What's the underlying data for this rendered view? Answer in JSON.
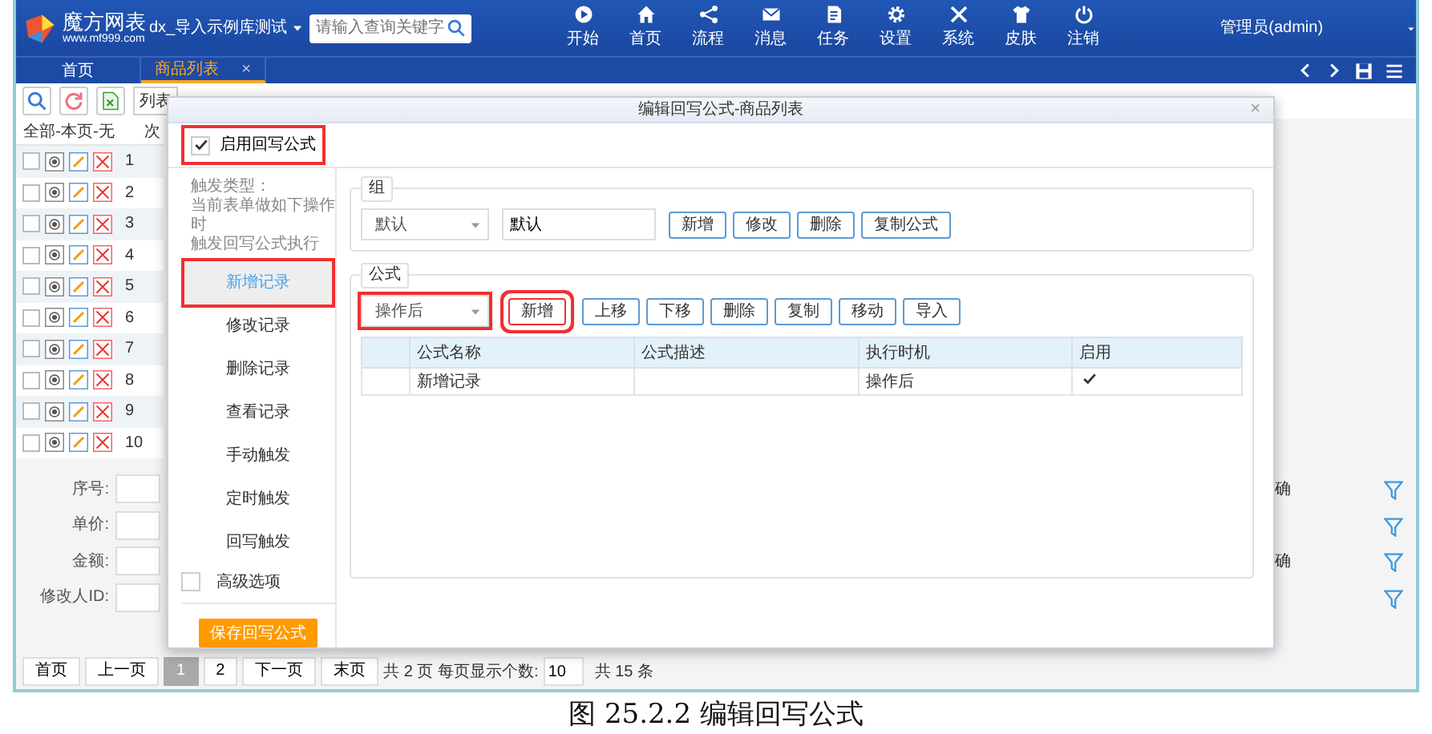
{
  "header": {
    "logo_title": "魔方网表",
    "logo_url": "www.mf999.com",
    "app_switcher": "dx_导入示例库测试",
    "search": {
      "placeholder": "请输入查询关键字"
    },
    "nav": [
      {
        "label": "开始"
      },
      {
        "label": "首页"
      },
      {
        "label": "流程"
      },
      {
        "label": "消息"
      },
      {
        "label": "任务"
      },
      {
        "label": "设置"
      },
      {
        "label": "系统"
      },
      {
        "label": "皮肤"
      },
      {
        "label": "注销"
      }
    ],
    "user": "管理员(admin)"
  },
  "tabs": [
    {
      "label": "首页",
      "selected": false
    },
    {
      "label": "商品列表",
      "selected": true,
      "close": "×"
    }
  ],
  "toolbar": {
    "view_select": "列表"
  },
  "grid": {
    "columns": [
      "全部-本页-无",
      "次"
    ],
    "rows": [
      {
        "number": "1",
        "checked": false
      },
      {
        "number": "2",
        "checked": false
      },
      {
        "number": "3",
        "checked": false
      },
      {
        "number": "4",
        "checked": false
      },
      {
        "number": "5",
        "checked": false
      },
      {
        "number": "6",
        "checked": false
      },
      {
        "number": "7",
        "checked": false
      },
      {
        "number": "8",
        "checked": false
      },
      {
        "number": "9",
        "checked": false
      },
      {
        "number": "10",
        "checked": false
      }
    ]
  },
  "form": {
    "fields": [
      {
        "label": "序号:",
        "right_label": "确"
      },
      {
        "label": "单价:"
      },
      {
        "label": "金额:",
        "right_label": "确"
      },
      {
        "label": "修改人ID:"
      }
    ]
  },
  "pagination": {
    "first": [
      "首页",
      "上一页"
    ],
    "pages": [
      {
        "label": "1",
        "selected": true
      },
      {
        "label": "2",
        "selected": false
      }
    ],
    "last": [
      "下一页",
      "末页"
    ],
    "summary": "共 2 页 每页显示个数:",
    "page_size": "10",
    "total": "共 15 条"
  },
  "dialog": {
    "title": "编辑回写公式-商品列表",
    "close": "×",
    "enable": {
      "label": "启用回写公式",
      "checked": true,
      "highlighted": true
    },
    "trigger_hint": [
      "触发类型：",
      "当前表单做如下操作时",
      "触发回写公式执行"
    ],
    "triggers": [
      {
        "label": "新增记录",
        "selected": true,
        "highlighted": true
      },
      {
        "label": "修改记录",
        "selected": false,
        "highlighted": false
      },
      {
        "label": "删除记录",
        "selected": false,
        "highlighted": false
      },
      {
        "label": "查看记录",
        "selected": false,
        "highlighted": false
      },
      {
        "label": "手动触发",
        "selected": false,
        "highlighted": false
      },
      {
        "label": "定时触发",
        "selected": false,
        "highlighted": false
      },
      {
        "label": "回写触发",
        "selected": false,
        "highlighted": false
      }
    ],
    "advanced": {
      "label": "高级选项",
      "checked": false
    },
    "save_button": "保存回写公式",
    "group": {
      "legend": "组",
      "select": "默认",
      "name_value": "默认",
      "buttons": [
        "新增",
        "修改",
        "删除",
        "复制公式"
      ]
    },
    "formula": {
      "legend": "公式",
      "select": {
        "value": "操作后",
        "highlighted": true
      },
      "buttons": [
        {
          "label": "新增",
          "highlighted": true
        },
        {
          "label": "上移",
          "highlighted": false
        },
        {
          "label": "下移",
          "highlighted": false
        },
        {
          "label": "删除",
          "highlighted": false
        },
        {
          "label": "复制",
          "highlighted": false
        },
        {
          "label": "移动",
          "highlighted": false
        },
        {
          "label": "导入",
          "highlighted": false
        }
      ],
      "table": {
        "columns": [
          "公式名称",
          "公式描述",
          "执行时机",
          "启用"
        ],
        "rows": [
          {
            "name": "新增记录",
            "timing": "操作后",
            "enabled": true
          }
        ]
      }
    }
  },
  "caption": "图 25.2.2 编辑回写公式"
}
